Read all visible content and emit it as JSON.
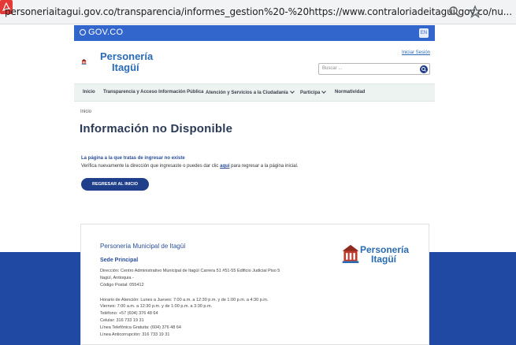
{
  "browser": {
    "url": "personeriaitagui.gov.co/transparencia/informes_gestion%20-%20https://www.contraloriadeitagui.gov.co/nu..."
  },
  "govbar": {
    "label": "GOV.CO"
  },
  "header": {
    "logo_line1": "Personería",
    "logo_line2": "Itagüí",
    "login": "Iniciar Sesión",
    "search_placeholder": "Buscar ..."
  },
  "nav": {
    "items": [
      {
        "label": "Inicio"
      },
      {
        "label": "Transparencia y Acceso Información Pública"
      },
      {
        "label": "Atención y Servicios a la Ciudadanía"
      },
      {
        "label": "Participa"
      },
      {
        "label": "Normatividad"
      }
    ]
  },
  "main": {
    "breadcrumb": "Inicio",
    "title": "Información no Disponible",
    "message_title": "La página a la que tratas de ingresar no existe",
    "message_before": "Verifica nuevamente la dirección que ingresaste o puedes dar clic ",
    "message_link": "aquí",
    "message_after": " para regresar a la página inicial.",
    "button": "REGRESAR AL INICIO"
  },
  "footer": {
    "title": "Personería Municipal de Itagüí",
    "subtitle": "Sede Principal",
    "lines": [
      "Dirección: Centro Administrativo Municipal de Itagüí Carrera 51 #51-55 Edificio Judicial Piso 5",
      "Itagüí, Antioquia -",
      "Código Postal: 055412",
      "",
      "Horario de Atención: Lunes a Jueves: 7:00 a.m. a 12:30 p.m. y de 1:00 p.m. a 4:30 p.m.",
      "Viernes: 7:00 a.m. a 12:30 p.m. y de 1:00 p.m. a 3:30 p.m.",
      "Teléfono: +57 (604) 376 48 64",
      "Celular: 316 733 19 31",
      "Línea Telefónica Gratuita: (604) 376 48 64",
      "Línea Anticorrupción: 316 733 19 31"
    ],
    "logo_line1": "Personería",
    "logo_line2": "Itagüí"
  },
  "colors": {
    "gov_blue": "#3366cc",
    "brand_blue": "#1f3f8a",
    "footer_blue": "#1f49a3"
  }
}
